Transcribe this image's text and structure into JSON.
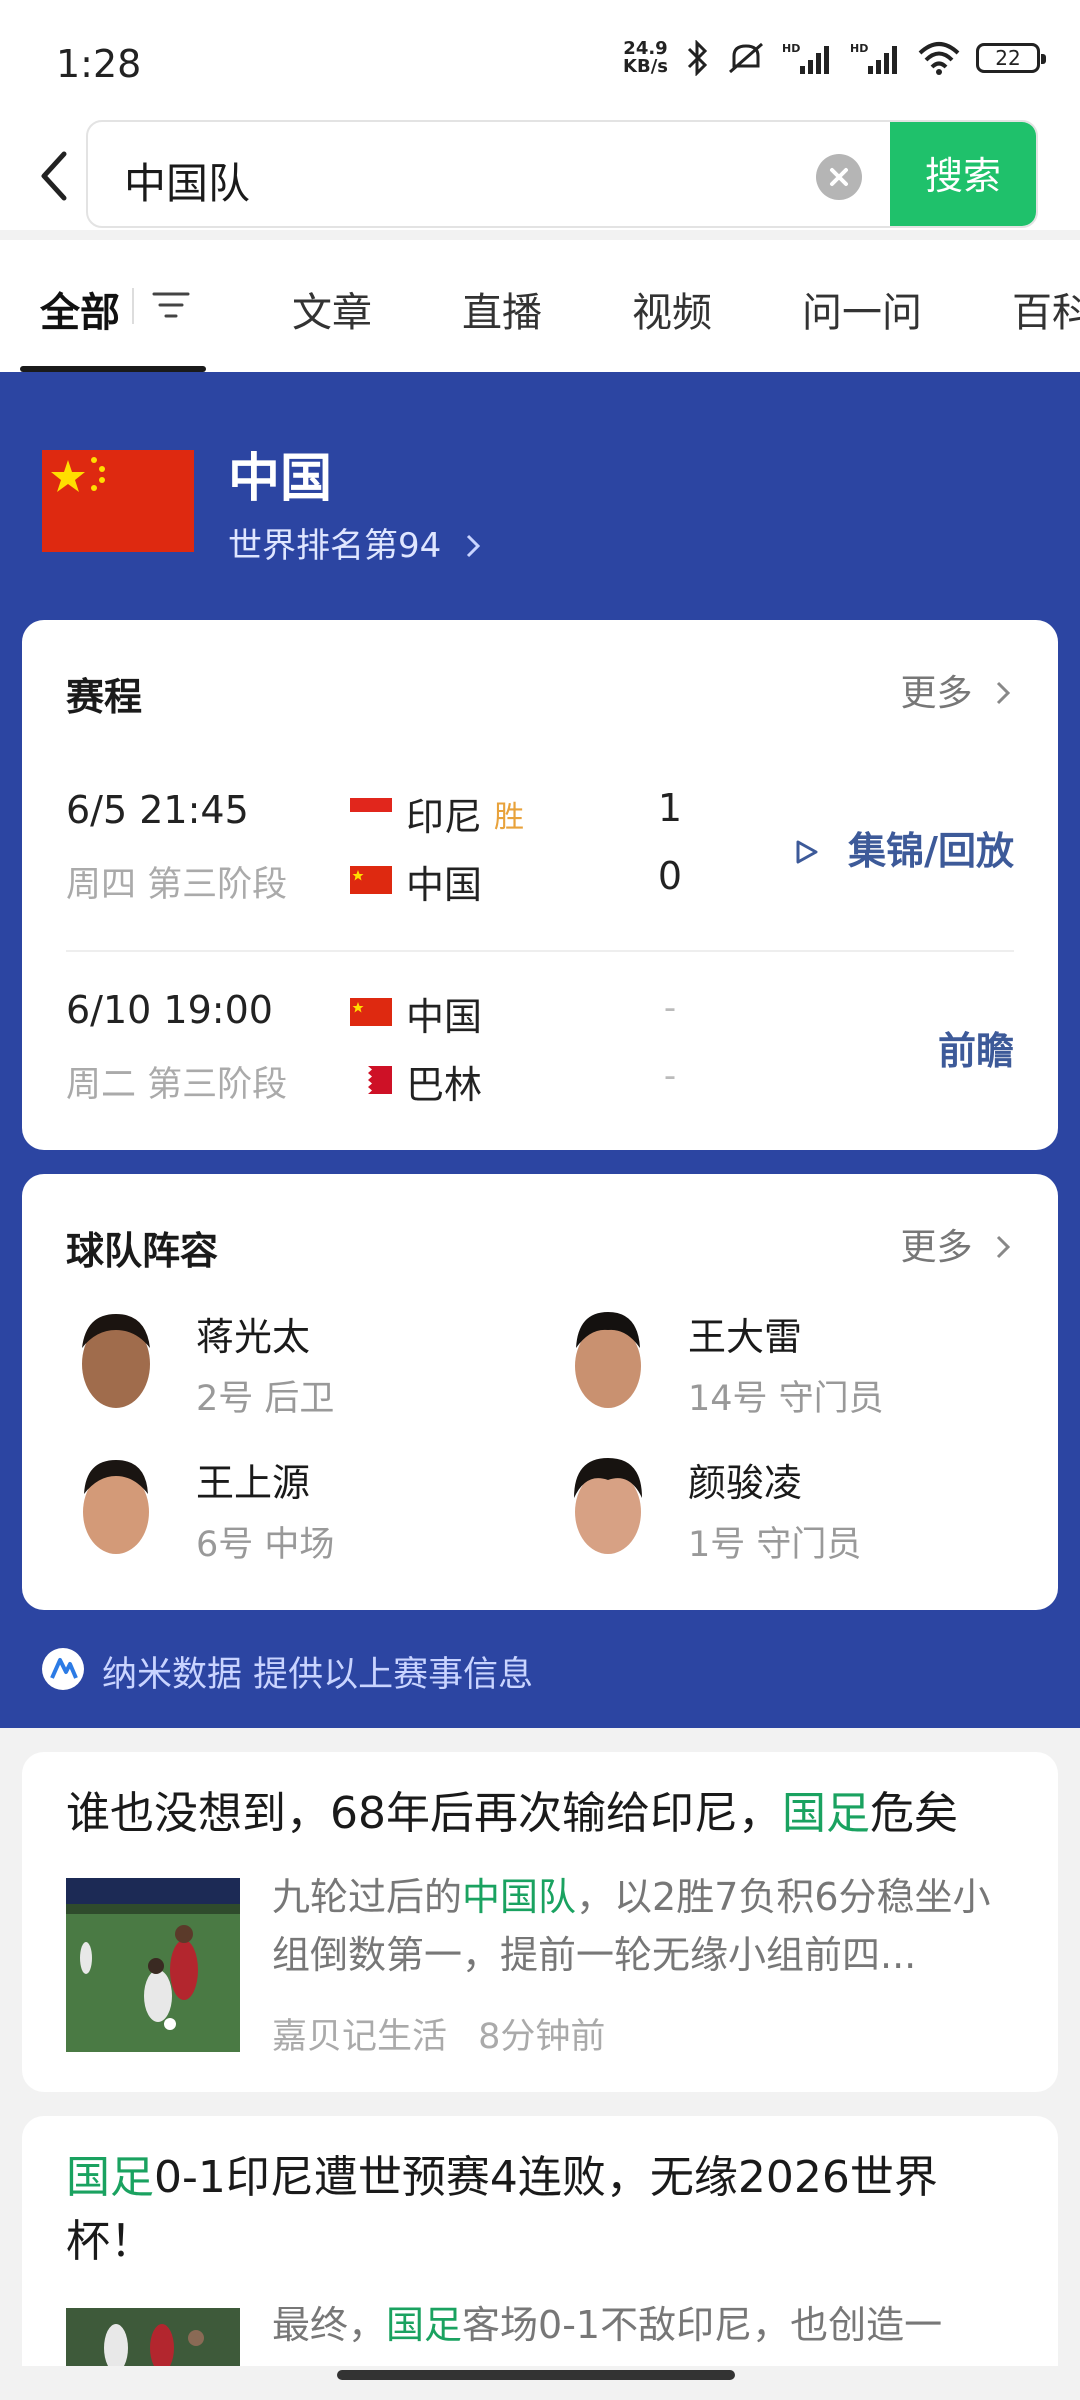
{
  "status_bar": {
    "time": "1:28",
    "net_speed_value": "24.9",
    "net_speed_unit": "KB/s",
    "battery": "22",
    "icons": [
      "bluetooth-icon",
      "mute-icon",
      "hd-signal-icon",
      "hd-signal-icon",
      "wifi-icon",
      "battery-icon"
    ]
  },
  "search": {
    "query": "中国队",
    "button_label": "搜索"
  },
  "tabs": [
    {
      "label": "全部",
      "active": true
    },
    {
      "label": "文章"
    },
    {
      "label": "直播"
    },
    {
      "label": "视频"
    },
    {
      "label": "问一问"
    },
    {
      "label": "百科"
    }
  ],
  "team": {
    "name": "中国",
    "ranking": "世界排名第94"
  },
  "schedule": {
    "title": "赛程",
    "more_label": "更多",
    "matches": [
      {
        "time": "6/5 21:45",
        "sub": "周四 第三阶段",
        "team1": "印尼",
        "team1_result": "胜",
        "score1": "1",
        "team2": "中国",
        "score2": "0",
        "action": "集锦/回放"
      },
      {
        "time": "6/10 19:00",
        "sub": "周二 第三阶段",
        "team1": "中国",
        "score1": "-",
        "team2": "巴林",
        "score2": "-",
        "action": "前瞻"
      }
    ]
  },
  "roster": {
    "title": "球队阵容",
    "more_label": "更多",
    "players": [
      {
        "name": "蒋光太",
        "info": "2号 后卫"
      },
      {
        "name": "王大雷",
        "info": "14号 守门员"
      },
      {
        "name": "王上源",
        "info": "6号 中场"
      },
      {
        "name": "颜骏凌",
        "info": "1号 守门员"
      }
    ]
  },
  "source_text": "纳米数据 提供以上赛事信息",
  "news": [
    {
      "title_parts": [
        "谁也没想到，68年后再次输给印尼，",
        "国足",
        "危矣"
      ],
      "desc_parts": [
        "九轮过后的",
        "中国队",
        "，以2胜7负积6分稳坐小组倒数第一，提前一轮无缘小组前四..."
      ],
      "author": "嘉贝记生活",
      "time": "8分钟前"
    },
    {
      "title_parts": [
        "国足",
        "0-1印尼遭世预赛4连败，无缘2026世界杯！"
      ],
      "desc_parts": [
        "最终，",
        "国足",
        "客场0-1不敌印尼，也创造一"
      ]
    }
  ],
  "colors": {
    "accent_green": "#1fc16b",
    "team_blue": "#2c45a2",
    "win_orange": "#e8a23b",
    "action_blue": "#3d5a99"
  }
}
